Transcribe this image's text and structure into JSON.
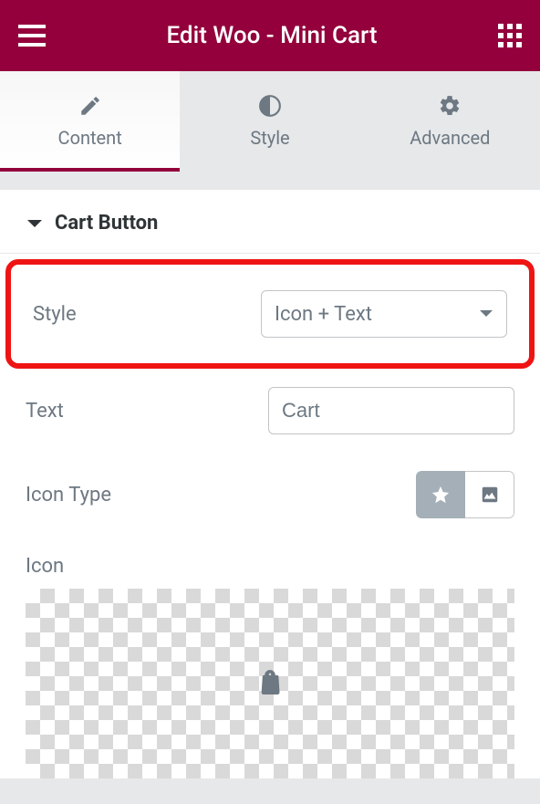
{
  "header": {
    "title": "Edit Woo - Mini Cart"
  },
  "tabs": [
    {
      "label": "Content",
      "icon": "pencil",
      "active": true
    },
    {
      "label": "Style",
      "icon": "half-circle",
      "active": false
    },
    {
      "label": "Advanced",
      "icon": "gear",
      "active": false
    }
  ],
  "section": {
    "title": "Cart Button",
    "expanded": true
  },
  "fields": {
    "style": {
      "label": "Style",
      "value": "Icon + Text"
    },
    "text": {
      "label": "Text",
      "value": "Cart"
    },
    "icon_type": {
      "label": "Icon Type",
      "selected": "star"
    },
    "icon": {
      "label": "Icon"
    }
  }
}
